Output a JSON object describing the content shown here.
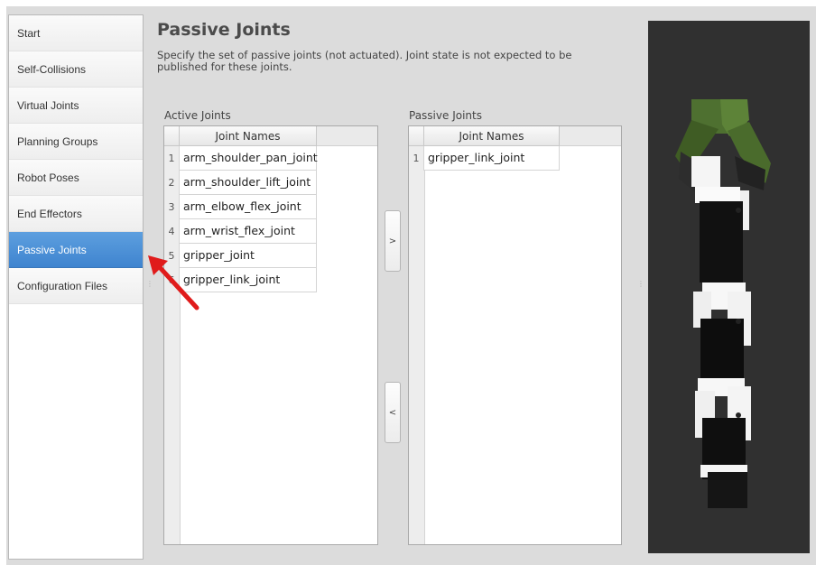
{
  "sidebar": {
    "items": [
      {
        "label": "Start",
        "active": false
      },
      {
        "label": "Self-Collisions",
        "active": false
      },
      {
        "label": "Virtual Joints",
        "active": false
      },
      {
        "label": "Planning Groups",
        "active": false
      },
      {
        "label": "Robot Poses",
        "active": false
      },
      {
        "label": "End Effectors",
        "active": false
      },
      {
        "label": "Passive Joints",
        "active": true
      },
      {
        "label": "Configuration Files",
        "active": false
      }
    ]
  },
  "page": {
    "title": "Passive Joints",
    "description": "Specify the set of passive joints (not actuated). Joint state is not expected to be published for these joints."
  },
  "active_joints": {
    "label": "Active Joints",
    "column_header": "Joint Names",
    "rows": [
      {
        "num": "1",
        "name": "arm_shoulder_pan_joint"
      },
      {
        "num": "2",
        "name": "arm_shoulder_lift_joint"
      },
      {
        "num": "3",
        "name": "arm_elbow_flex_joint"
      },
      {
        "num": "4",
        "name": "arm_wrist_flex_joint"
      },
      {
        "num": "5",
        "name": "gripper_joint"
      },
      {
        "num": "6",
        "name": "gripper_link_joint"
      }
    ]
  },
  "passive_joints": {
    "label": "Passive Joints",
    "column_header": "Joint Names",
    "rows": [
      {
        "num": "1",
        "name": "gripper_link_joint"
      }
    ]
  },
  "buttons": {
    "move_right": ">",
    "move_left": "<"
  },
  "colors": {
    "active_nav": "#4a8fd6",
    "viewer_bg": "#303030",
    "gripper_green": "#4a6b2c",
    "arrow_red": "#e01b1b"
  }
}
